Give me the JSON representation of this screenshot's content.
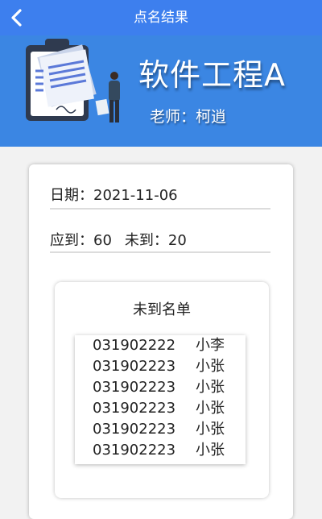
{
  "header": {
    "title": "点名结果",
    "back_icon": "chevron-left-icon"
  },
  "course": {
    "name": "软件工程A",
    "teacher": "老师：柯逍",
    "illustration_icon": "clipboard-person-icon"
  },
  "summary": {
    "date_label": "日期：",
    "date_value": "2021-11-06",
    "expected_label": "应到：",
    "expected_value": "60",
    "absent_label": "未到：",
    "absent_value": "20"
  },
  "absent_list": {
    "title": "未到名单",
    "students": [
      {
        "id": "031902222",
        "name": "小李"
      },
      {
        "id": "031902223",
        "name": "小张"
      },
      {
        "id": "031902223",
        "name": "小张"
      },
      {
        "id": "031902223",
        "name": "小张"
      },
      {
        "id": "031902223",
        "name": "小张"
      },
      {
        "id": "031902223",
        "name": "小张"
      }
    ]
  },
  "colors": {
    "titlebar": "#3d7fee",
    "hero": "#3b86e3"
  }
}
